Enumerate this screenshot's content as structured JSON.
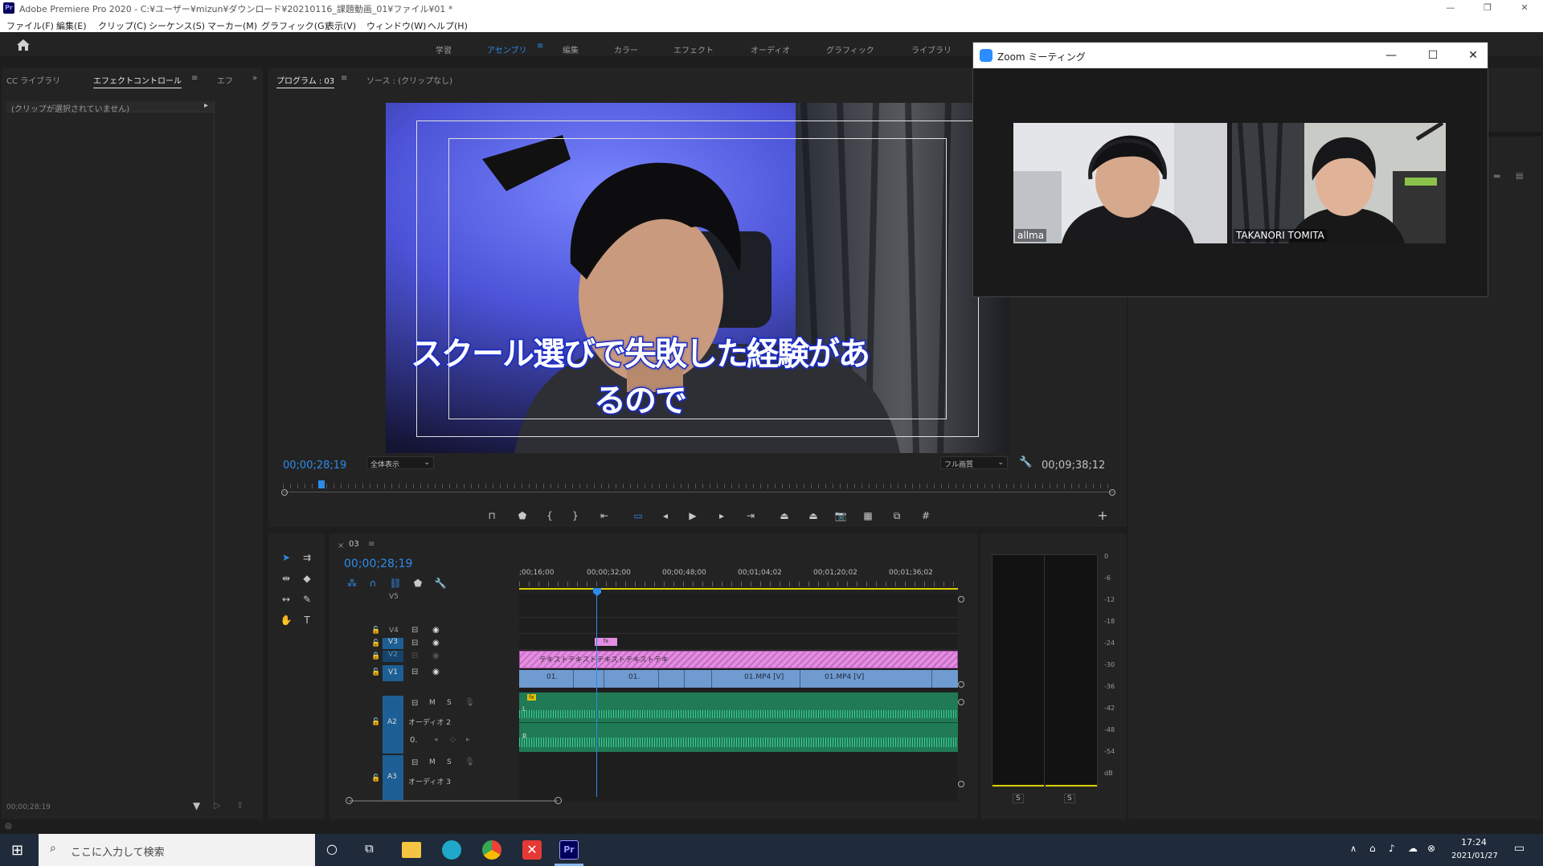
{
  "window": {
    "title": "Adobe Premiere Pro 2020 - C:¥ユーザー¥mizun¥ダウンロード¥20210116_課題動画_01¥ファイル¥01 *",
    "logo": "Pr"
  },
  "menu": [
    "ファイル(F)",
    "編集(E)",
    "クリップ(C)",
    "シーケンス(S)",
    "マーカー(M)",
    "グラフィック(G)",
    "表示(V)",
    "ウィンドウ(W)",
    "ヘルプ(H)"
  ],
  "workspaces": [
    "学習",
    "アセンブリ",
    "編集",
    "カラー",
    "エフェクト",
    "オーディオ",
    "グラフィック",
    "ライブラリ"
  ],
  "active_workspace_index": 1,
  "left_panel": {
    "tabs": [
      "CC ライブラリ",
      "エフェクトコントロール",
      "エフ"
    ],
    "selected_tab_index": 1,
    "empty_msg": "(クリップが選択されていません)",
    "footer_tc": "00;00;28;19"
  },
  "program_monitor": {
    "tab_label": "プログラム : 03",
    "source_label": "ソース : (クリップなし)",
    "subtitle": "スクール選びで失敗した経験があるので",
    "current_tc": "00;00;28;19",
    "zoom_select": "全体表示",
    "quality_select": "フル画質",
    "duration_tc": "00;09;38;12",
    "playhead_fraction": 0.043
  },
  "timeline": {
    "sequence_name": "03",
    "current_tc": "00;00;28;19",
    "ruler_ticks": [
      ";00;16;00",
      "00;00;32;00",
      "00;00;48;00",
      "00;01;04;02",
      "00;01;20;02",
      "00;01;36;02"
    ],
    "v5_label": "V5",
    "tracks": {
      "v4": "V4",
      "v3": "V3",
      "v2": "V2",
      "v1": "V1",
      "a2": "A2",
      "a3": "A3",
      "a2_name": "オーディオ 2",
      "a3_name": "オーディオ 3",
      "m": "M",
      "s": "S",
      "a2_vol": "0."
    },
    "text_clip_label": "テキストテキストテキストテキストテキ",
    "fx_badge": "fx",
    "v1_clips": [
      "01.",
      "01.",
      "01.MP4 [V]",
      "01.MP4 [V]"
    ],
    "audio_l": "L",
    "audio_r": "R"
  },
  "audio_meter": {
    "scale": [
      "0",
      "-6",
      "-12",
      "-18",
      "-24",
      "-30",
      "-36",
      "-42",
      "-48",
      "-54",
      "dB"
    ],
    "solo_left": "S",
    "solo_right": "S"
  },
  "zoom_window": {
    "title": "Zoom ミーティング",
    "participants": [
      "allma",
      "TAKANORI TOMITA"
    ]
  },
  "taskbar": {
    "search_placeholder": "ここに入力して検索",
    "time": "17:24",
    "date": "2021/01/27",
    "pr_label": "Pr"
  },
  "colors": {
    "accent_blue": "#2d8ceb",
    "text_clip_pink": "#e38ee0",
    "video_clip_blue": "#6f9bd0",
    "audio_clip_green": "#1f7a55",
    "track_highlight_blue": "#1d5f95"
  }
}
